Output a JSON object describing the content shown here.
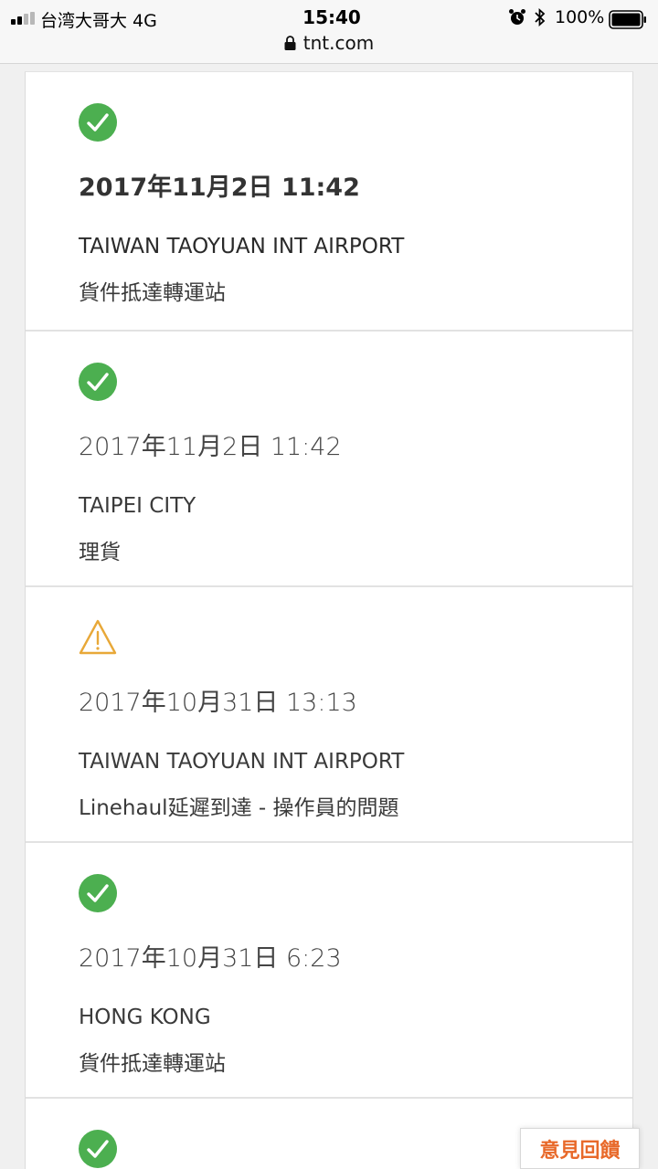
{
  "status_bar": {
    "carrier": "台湾大哥大  4G",
    "time": "15:40",
    "battery": "100%",
    "url": "tnt.com"
  },
  "icons": {
    "success": "check-circle-icon",
    "warning": "warning-triangle-icon"
  },
  "colors": {
    "success": "#4caf50",
    "warning": "#e8a838",
    "feedback": "#e8692a"
  },
  "events": [
    {
      "status": "success",
      "date": "2017年11月2日 11:42",
      "location": "TAIWAN TAOYUAN INT AIRPORT",
      "description": "貨件抵達轉運站"
    },
    {
      "status": "success",
      "date": "2017年11月2日 11:42",
      "location": "TAIPEI CITY",
      "description": "理貨"
    },
    {
      "status": "warning",
      "date": "2017年10月31日 13:13",
      "location": "TAIWAN TAOYUAN INT AIRPORT",
      "description": "Linehaul延遲到達 - 操作員的問題"
    },
    {
      "status": "success",
      "date": "2017年10月31日 6:23",
      "location": "HONG KONG",
      "description": "貨件抵達轉運站"
    },
    {
      "status": "success"
    }
  ],
  "feedback_label": "意見回饋"
}
